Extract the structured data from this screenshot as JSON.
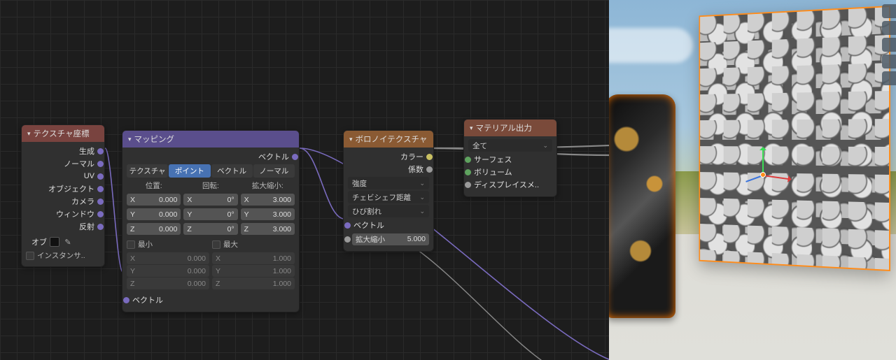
{
  "nodes": {
    "texcoord": {
      "title": "テクスチャ座標",
      "outputs": [
        "生成",
        "ノーマル",
        "UV",
        "オブジェクト",
        "カメラ",
        "ウィンドウ",
        "反射"
      ],
      "object_label": "オブ",
      "instancer_label": "インスタンサ.."
    },
    "mapping": {
      "title": "マッピング",
      "vector_out": "ベクトル",
      "tabs": [
        "テクスチャ",
        "ポイント",
        "ベクトル",
        "ノーマル"
      ],
      "active_tab": 1,
      "col_headers": [
        "位置:",
        "回転:",
        "拡大縮小:"
      ],
      "axes": [
        "X",
        "Y",
        "Z"
      ],
      "location": [
        "0.000",
        "0.000",
        "0.000"
      ],
      "rotation": [
        "0°",
        "0°",
        "0°"
      ],
      "scale": [
        "3.000",
        "3.000",
        "3.000"
      ],
      "min_label": "最小",
      "max_label": "最大",
      "min_vals": [
        "0.000",
        "0.000",
        "0.000"
      ],
      "max_vals": [
        "1.000",
        "1.000",
        "1.000"
      ],
      "vector_in": "ベクトル"
    },
    "voronoi": {
      "title": "ボロノイテクスチャ",
      "color_out": "カラー",
      "fac_out": "係数",
      "intensity_sel": "強度",
      "distance_sel": "チェビシェフ距離",
      "crack_sel": "ひび割れ",
      "vector_in": "ベクトル",
      "scale_label": "拡大縮小",
      "scale_value": "5.000"
    },
    "matout": {
      "title": "マテリアル出力",
      "target_sel": "全て",
      "surface_in": "サーフェス",
      "volume_in": "ボリューム",
      "displace_in": "ディスプレイスメ.."
    }
  }
}
